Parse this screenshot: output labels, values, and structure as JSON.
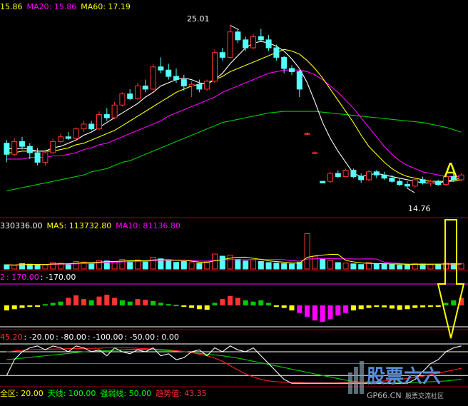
{
  "colors": {
    "background": "#000000",
    "candle_up": "#ff3232",
    "candle_down": "#54ffff",
    "ma5": "#ffffff",
    "ma10": "#ffff00",
    "ma20": "#ff00ff",
    "ma60": "#00cc00",
    "panel_border": "#a00000",
    "label_white": "#ffffff",
    "label_yellow": "#ffff00",
    "label_magenta": "#ff00ff",
    "label_red": "#ff3232",
    "label_green": "#00ff00",
    "label_cyan": "#54ffff"
  },
  "chart_data": {
    "type": "candlestick",
    "price_panel": {
      "legend": {
        "ma10": "15.86",
        "ma20": "MA20: 15.86",
        "ma60": "MA60: 17.19"
      },
      "high_label": "25.01",
      "low_label": "14.76",
      "marker_letter": "A"
    },
    "volume_panel": {
      "legend": {
        "vol": "330336.00",
        "ma5": "MA5: 113732.80",
        "ma10": "MA10: 81136.80"
      }
    },
    "indicator1": {
      "legend": {
        "prefix": "2",
        "v1": ": 170.00",
        "v2": ": -170.00"
      }
    },
    "indicator2": {
      "legend": {
        "v1": "45.20",
        "v2": ": -20.00",
        "v3": ": -80.00",
        "v4": ": -100.00",
        "v5": ": -50.00",
        "v6": ": 0.00"
      }
    },
    "bottom_legend": {
      "zone": "全区: 20.00",
      "sky": "天线: 100.00",
      "strength": "强弱线: 50.00",
      "trend": "趋势值: 43.35"
    },
    "candles": [
      [
        17.6,
        17.8,
        16.4,
        16.9
      ],
      [
        16.9,
        17.9,
        16.8,
        17.7
      ],
      [
        17.7,
        18.0,
        17.2,
        17.4
      ],
      [
        17.4,
        17.6,
        16.6,
        17.0
      ],
      [
        17.0,
        17.3,
        16.2,
        16.4
      ],
      [
        16.4,
        17.2,
        16.2,
        17.0
      ],
      [
        17.0,
        17.9,
        16.9,
        17.7
      ],
      [
        17.7,
        18.2,
        17.6,
        18.0
      ],
      [
        18.0,
        18.3,
        17.8,
        17.9
      ],
      [
        17.9,
        18.6,
        17.8,
        18.5
      ],
      [
        18.5,
        19.0,
        18.3,
        18.8
      ],
      [
        18.8,
        19.0,
        18.4,
        18.5
      ],
      [
        18.5,
        19.6,
        18.4,
        19.4
      ],
      [
        19.4,
        19.8,
        19.0,
        19.2
      ],
      [
        19.2,
        20.2,
        19.1,
        20.0
      ],
      [
        20.0,
        20.8,
        19.9,
        20.7
      ],
      [
        20.7,
        21.0,
        20.3,
        20.4
      ],
      [
        20.4,
        21.4,
        20.3,
        21.2
      ],
      [
        21.2,
        21.6,
        20.8,
        21.0
      ],
      [
        21.0,
        22.6,
        20.9,
        22.4
      ],
      [
        22.4,
        23.0,
        22.0,
        22.2
      ],
      [
        22.2,
        22.6,
        21.6,
        21.8
      ],
      [
        21.8,
        22.3,
        21.4,
        21.6
      ],
      [
        21.6,
        21.9,
        20.9,
        21.2
      ],
      [
        21.2,
        21.5,
        20.5,
        21.3
      ],
      [
        21.3,
        21.6,
        20.8,
        21.0
      ],
      [
        21.0,
        21.6,
        20.9,
        21.5
      ],
      [
        21.5,
        23.5,
        21.4,
        23.3
      ],
      [
        23.3,
        23.6,
        22.8,
        23.0
      ],
      [
        23.0,
        25.01,
        22.9,
        24.6
      ],
      [
        24.6,
        24.8,
        23.9,
        24.1
      ],
      [
        24.1,
        24.3,
        23.4,
        23.6
      ],
      [
        23.6,
        24.5,
        23.5,
        24.3
      ],
      [
        24.3,
        24.8,
        24.0,
        24.1
      ],
      [
        24.1,
        24.4,
        23.4,
        23.6
      ],
      [
        23.6,
        23.8,
        22.8,
        23.0
      ],
      [
        23.0,
        23.1,
        22.0,
        22.3
      ],
      [
        22.3,
        22.5,
        21.9,
        22.1
      ],
      [
        22.1,
        22.2,
        20.5,
        21.0
      ],
      [
        18.2,
        18.3,
        18.2,
        18.2
      ],
      [
        17.0,
        17.1,
        16.9,
        17.0
      ],
      [
        15.2,
        15.2,
        15.1,
        15.1
      ],
      [
        15.2,
        15.8,
        15.1,
        15.7
      ],
      [
        15.7,
        15.9,
        15.4,
        15.5
      ],
      [
        15.5,
        16.0,
        15.5,
        15.9
      ],
      [
        15.9,
        16.0,
        15.4,
        15.5
      ],
      [
        15.5,
        15.7,
        15.1,
        15.3
      ],
      [
        15.3,
        15.9,
        15.2,
        15.8
      ],
      [
        15.8,
        15.9,
        15.4,
        15.6
      ],
      [
        15.6,
        15.8,
        15.3,
        15.4
      ],
      [
        15.4,
        15.6,
        15.1,
        15.2
      ],
      [
        15.2,
        15.4,
        14.9,
        15.0
      ],
      [
        15.0,
        15.2,
        14.76,
        14.9
      ],
      [
        14.9,
        15.4,
        14.8,
        15.3
      ],
      [
        15.3,
        15.5,
        15.0,
        15.1
      ],
      [
        15.1,
        15.3,
        14.9,
        15.2
      ],
      [
        15.2,
        15.3,
        14.9,
        15.0
      ],
      [
        15.0,
        15.6,
        14.9,
        15.5
      ],
      [
        15.5,
        15.7,
        15.2,
        15.3
      ],
      [
        15.3,
        15.7,
        15.2,
        15.6
      ]
    ],
    "ma5": [
      17.3,
      17.2,
      17.3,
      17.2,
      17.1,
      17.1,
      17.3,
      17.4,
      17.6,
      17.8,
      18.1,
      18.3,
      18.6,
      18.9,
      19.2,
      19.5,
      19.8,
      20.1,
      20.5,
      20.8,
      21.2,
      21.4,
      21.6,
      21.7,
      21.6,
      21.4,
      21.3,
      21.6,
      22.0,
      22.6,
      23.1,
      23.6,
      23.9,
      24.0,
      23.9,
      23.7,
      23.4,
      22.9,
      22.3,
      21.4,
      20.2,
      18.9,
      17.9,
      17.1,
      16.4,
      15.7,
      15.5,
      15.6,
      15.7,
      15.6,
      15.5,
      15.4,
      15.3,
      15.2,
      15.1,
      15.1,
      15.1,
      15.2,
      15.3,
      15.4
    ],
    "ma10": [
      17.0,
      17.0,
      17.1,
      17.1,
      17.1,
      17.1,
      17.1,
      17.2,
      17.3,
      17.5,
      17.6,
      17.8,
      18.0,
      18.2,
      18.4,
      18.7,
      19.0,
      19.3,
      19.6,
      19.9,
      20.2,
      20.5,
      20.8,
      21.0,
      21.2,
      21.3,
      21.4,
      21.6,
      21.8,
      22.1,
      22.3,
      22.5,
      22.7,
      22.9,
      23.1,
      23.3,
      23.5,
      23.4,
      23.2,
      22.8,
      22.3,
      21.7,
      21.0,
      20.3,
      19.6,
      18.9,
      18.1,
      17.4,
      16.9,
      16.4,
      16.0,
      15.7,
      15.5,
      15.4,
      15.3,
      15.2,
      15.2,
      15.2,
      15.2,
      15.3
    ],
    "ma20": [
      16.6,
      16.6,
      16.6,
      16.7,
      16.7,
      16.7,
      16.8,
      16.8,
      16.9,
      17.0,
      17.2,
      17.3,
      17.5,
      17.6,
      17.8,
      18.0,
      18.2,
      18.4,
      18.6,
      18.8,
      19.0,
      19.3,
      19.5,
      19.7,
      19.9,
      20.1,
      20.3,
      20.5,
      20.8,
      21.0,
      21.2,
      21.4,
      21.6,
      21.8,
      22.0,
      22.1,
      22.2,
      22.2,
      22.2,
      22.1,
      21.9,
      21.6,
      21.2,
      20.8,
      20.3,
      19.8,
      19.2,
      18.6,
      18.0,
      17.4,
      16.9,
      16.5,
      16.2,
      16.0,
      15.8,
      15.7,
      15.6,
      15.5,
      15.5,
      15.5
    ],
    "ma60": [
      14.6,
      14.7,
      14.8,
      14.9,
      15.0,
      15.1,
      15.2,
      15.3,
      15.4,
      15.5,
      15.6,
      15.8,
      15.9,
      16.0,
      16.2,
      16.4,
      16.5,
      16.7,
      16.9,
      17.1,
      17.3,
      17.5,
      17.7,
      17.9,
      18.1,
      18.3,
      18.5,
      18.7,
      18.9,
      19.0,
      19.1,
      19.2,
      19.3,
      19.4,
      19.5,
      19.55,
      19.6,
      19.6,
      19.6,
      19.6,
      19.6,
      19.55,
      19.5,
      19.45,
      19.4,
      19.35,
      19.3,
      19.25,
      19.2,
      19.15,
      19.1,
      19.05,
      19.0,
      18.95,
      18.9,
      18.8,
      18.7,
      18.6,
      18.45,
      18.3
    ],
    "volume": [
      40,
      35,
      50,
      45,
      42,
      38,
      60,
      55,
      48,
      70,
      65,
      58,
      80,
      75,
      68,
      90,
      72,
      85,
      66,
      110,
      95,
      78,
      62,
      70,
      58,
      52,
      66,
      140,
      120,
      130,
      90,
      75,
      85,
      70,
      60,
      55,
      50,
      48,
      62,
      330,
      120,
      90,
      80,
      60,
      55,
      48,
      42,
      60,
      50,
      45,
      40,
      38,
      45,
      52,
      48,
      42,
      40,
      55,
      50,
      48
    ],
    "ind1": [
      -40,
      -30,
      -20,
      -10,
      0,
      10,
      20,
      30,
      60,
      80,
      50,
      40,
      70,
      85,
      60,
      40,
      30,
      50,
      45,
      35,
      20,
      10,
      5,
      -10,
      -20,
      -30,
      -35,
      20,
      50,
      75,
      60,
      40,
      30,
      40,
      20,
      0,
      -20,
      -40,
      -60,
      -90,
      -120,
      -130,
      -110,
      -80,
      -60,
      -40,
      -30,
      -20,
      -10,
      -15,
      -25,
      -35,
      -30,
      -20,
      -15,
      -10,
      -5,
      20,
      40,
      60
    ],
    "ind2_white": [
      -80,
      -40,
      -20,
      -10,
      -5,
      -15,
      -5,
      -10,
      -20,
      -5,
      -10,
      -20,
      -15,
      -30,
      -10,
      -20,
      -25,
      -15,
      -20,
      -10,
      -30,
      -25,
      -40,
      -35,
      -20,
      -15,
      -30,
      -10,
      -20,
      -5,
      -15,
      -20,
      -10,
      -30,
      -50,
      -70,
      -90,
      -100,
      -100,
      -100,
      -100,
      -100,
      -100,
      -100,
      -100,
      -100,
      -100,
      -100,
      -100,
      -100,
      -100,
      -100,
      -100,
      -90,
      -70,
      -50,
      -40,
      -20,
      -10,
      -5
    ],
    "ind2_red": [
      -20,
      -18,
      -16,
      -15,
      -14,
      -14,
      -13,
      -13,
      -12,
      -12,
      -12,
      -11,
      -11,
      -10,
      -10,
      -10,
      -10,
      -11,
      -12,
      -13,
      -14,
      -15,
      -17,
      -19,
      -22,
      -26,
      -30,
      -36,
      -44,
      -55,
      -66,
      -76,
      -84,
      -90,
      -94,
      -96,
      -97,
      -98,
      -98,
      -99,
      -99,
      -99,
      -99,
      -99,
      -98,
      -98,
      -97,
      -96,
      -95,
      -94,
      -92,
      -90,
      -88,
      -85,
      -82,
      -78,
      -74,
      -70,
      -66,
      -62
    ],
    "ind2_green": [
      -40,
      -38,
      -36,
      -34,
      -32,
      -30,
      -28,
      -26,
      -24,
      -22,
      -20,
      -19,
      -18,
      -17,
      -16,
      -15,
      -14,
      -14,
      -14,
      -15,
      -16,
      -17,
      -18,
      -20,
      -22,
      -24,
      -26,
      -28,
      -30,
      -33,
      -36,
      -40,
      -44,
      -48,
      -52,
      -56,
      -60,
      -64,
      -68,
      -72,
      -76,
      -80,
      -84,
      -88,
      -92,
      -95,
      -97,
      -98,
      -99,
      -99,
      -99,
      -99,
      -99,
      -98,
      -97,
      -96,
      -95,
      -94,
      -92,
      -90
    ]
  },
  "logo": {
    "name": "股票六六",
    "url_text": "GP66.CN",
    "slogan": "股票交流社区"
  }
}
